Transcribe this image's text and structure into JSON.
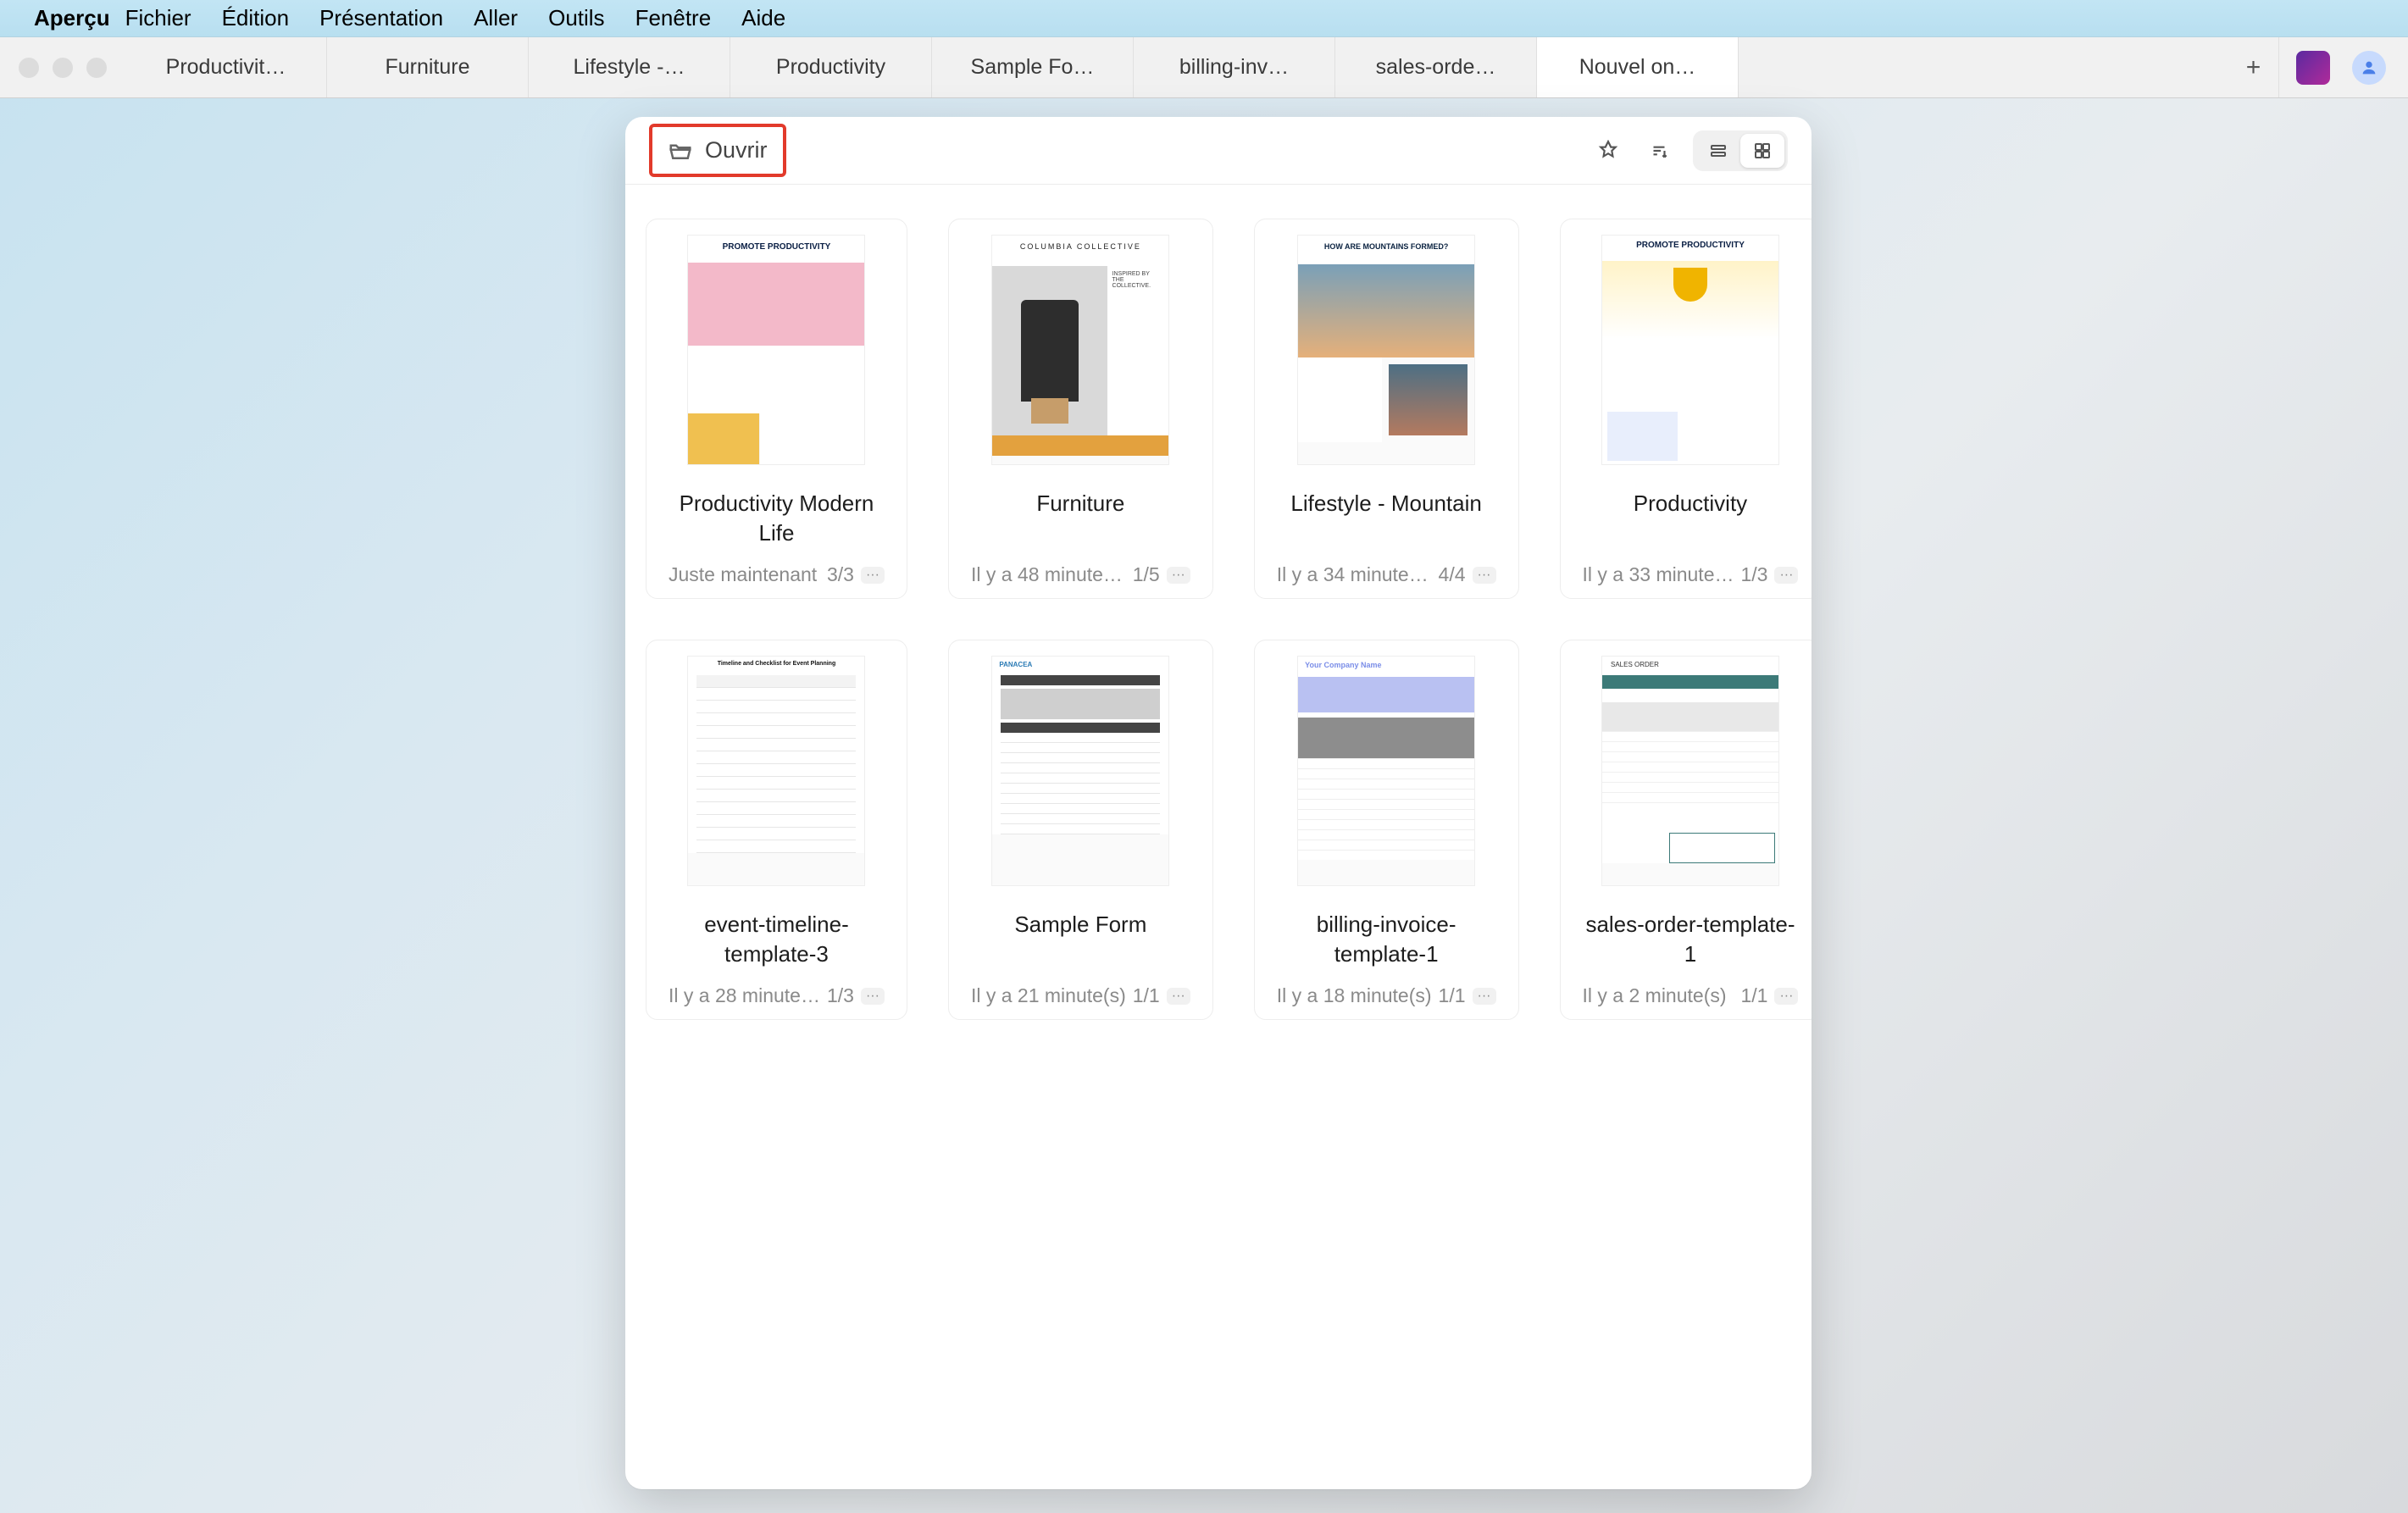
{
  "menubar": {
    "app": "Aperçu",
    "items": [
      "Fichier",
      "Édition",
      "Présentation",
      "Aller",
      "Outils",
      "Fenêtre",
      "Aide"
    ]
  },
  "tabs": [
    {
      "label": "Productivit…"
    },
    {
      "label": "Furniture"
    },
    {
      "label": "Lifestyle -…"
    },
    {
      "label": "Productivity"
    },
    {
      "label": "Sample Fo…"
    },
    {
      "label": "billing-inv…"
    },
    {
      "label": "sales-orde…"
    },
    {
      "label": "Nouvel on…",
      "active": true
    }
  ],
  "toolbar": {
    "open_label": "Ouvrir"
  },
  "files": [
    {
      "title": "Productivity Modern Life",
      "time": "Juste maintenant",
      "pages": "3/3",
      "thumb": "tA",
      "caption": "PROMOTE PRODUCTIVITY"
    },
    {
      "title": "Furniture",
      "time": "Il y a 48 minute…",
      "pages": "1/5",
      "thumb": "tB",
      "caption": "COLUMBIA COLLECTIVE"
    },
    {
      "title": "Lifestyle - Mountain",
      "time": "Il y a 34 minute…",
      "pages": "4/4",
      "thumb": "tC",
      "caption": "HOW ARE MOUNTAINS FORMED?"
    },
    {
      "title": "Productivity",
      "time": "Il y a 33 minute…",
      "pages": "1/3",
      "thumb": "tD",
      "caption": "PROMOTE PRODUCTIVITY"
    },
    {
      "title": "event-timeline-template-3",
      "time": "Il y a 28 minute…",
      "pages": "1/3",
      "thumb": "tE",
      "caption": "Timeline and Checklist for Event Planning"
    },
    {
      "title": "Sample Form",
      "time": "Il y a 21 minute(s)",
      "pages": "1/1",
      "thumb": "tF",
      "caption": "PANACEA"
    },
    {
      "title": "billing-invoice-template-1",
      "time": "Il y a 18 minute(s)",
      "pages": "1/1",
      "thumb": "tG",
      "caption": "Your Company Name"
    },
    {
      "title": "sales-order-template-1",
      "time": "Il y a 2 minute(s)",
      "pages": "1/1",
      "thumb": "tH",
      "caption": "SALES ORDER"
    }
  ]
}
